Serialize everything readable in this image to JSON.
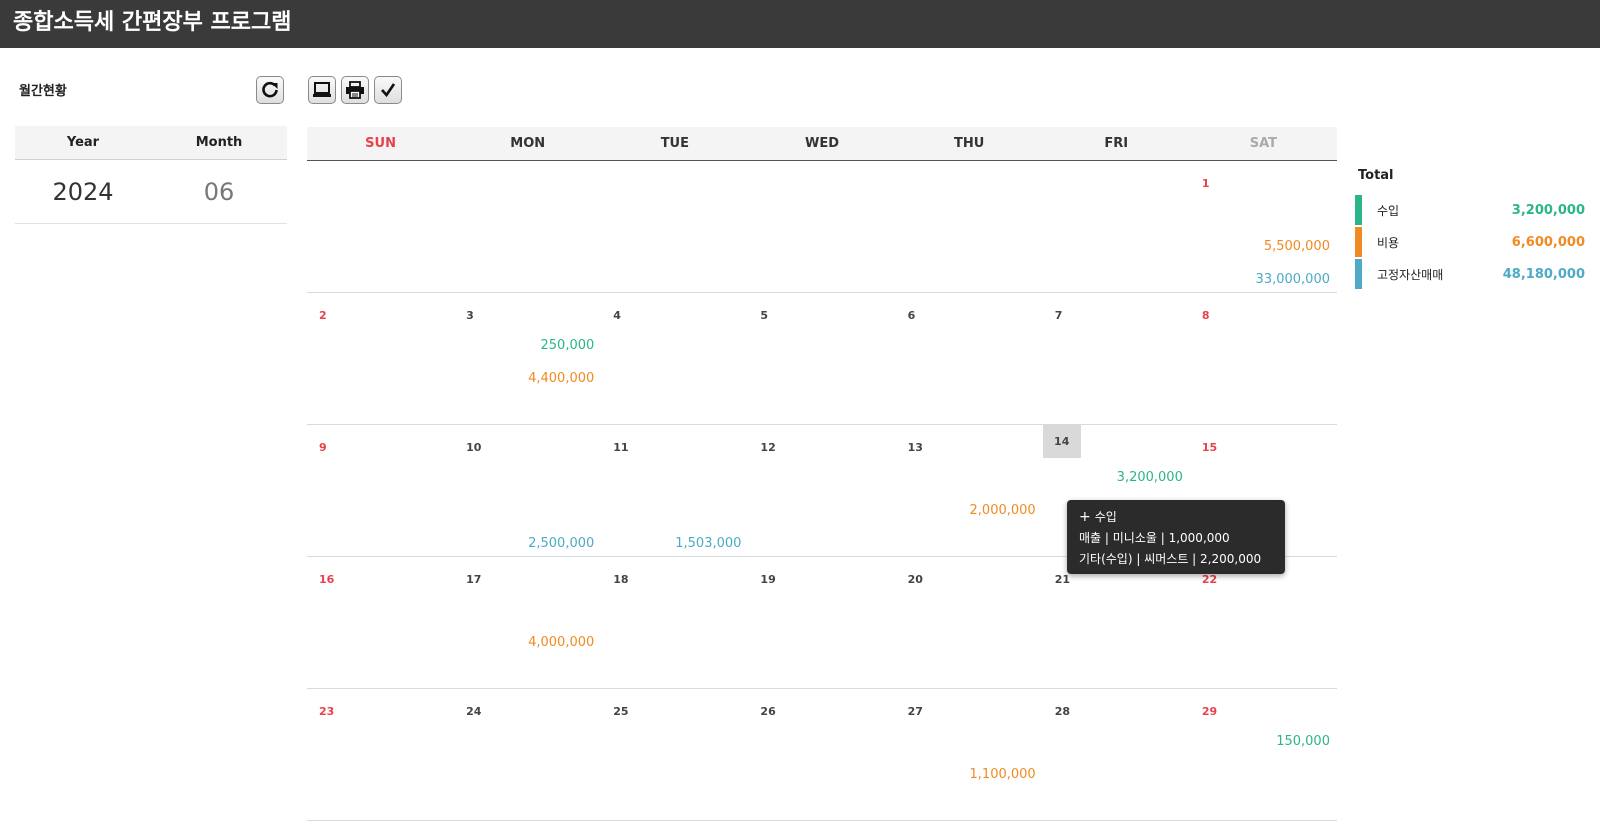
{
  "app": {
    "title": "종합소득세 간편장부 프로그램"
  },
  "left": {
    "section_label": "월간현황",
    "year_header": "Year",
    "month_header": "Month",
    "year": "2024",
    "month": "06"
  },
  "toolbar": {
    "refresh_icon": "refresh-icon",
    "computer_icon": "computer-icon",
    "print_icon": "printer-icon",
    "check_icon": "checkmark-icon"
  },
  "calendar": {
    "weekdays": [
      "SUN",
      "MON",
      "TUE",
      "WED",
      "THU",
      "FRI",
      "SAT"
    ],
    "today": "14",
    "weeks": [
      [
        {
          "day": "",
          "income": "",
          "expense": "",
          "asset": ""
        },
        {
          "day": "",
          "income": "",
          "expense": "",
          "asset": ""
        },
        {
          "day": "",
          "income": "",
          "expense": "",
          "asset": ""
        },
        {
          "day": "",
          "income": "",
          "expense": "",
          "asset": ""
        },
        {
          "day": "",
          "income": "",
          "expense": "",
          "asset": ""
        },
        {
          "day": "",
          "income": "",
          "expense": "",
          "asset": ""
        },
        {
          "day": "1",
          "income": "",
          "expense": "5,500,000",
          "asset": "33,000,000"
        }
      ],
      [
        {
          "day": "2",
          "income": "",
          "expense": "",
          "asset": ""
        },
        {
          "day": "3",
          "income": "250,000",
          "expense": "4,400,000",
          "asset": ""
        },
        {
          "day": "4",
          "income": "",
          "expense": "",
          "asset": ""
        },
        {
          "day": "5",
          "income": "",
          "expense": "",
          "asset": ""
        },
        {
          "day": "6",
          "income": "",
          "expense": "",
          "asset": ""
        },
        {
          "day": "7",
          "income": "",
          "expense": "",
          "asset": ""
        },
        {
          "day": "8",
          "income": "",
          "expense": "",
          "asset": ""
        }
      ],
      [
        {
          "day": "9",
          "income": "",
          "expense": "",
          "asset": ""
        },
        {
          "day": "10",
          "income": "",
          "expense": "",
          "asset": "2,500,000"
        },
        {
          "day": "11",
          "income": "",
          "expense": "",
          "asset": "1,503,000"
        },
        {
          "day": "12",
          "income": "",
          "expense": "",
          "asset": ""
        },
        {
          "day": "13",
          "income": "",
          "expense": "2,000,000",
          "asset": ""
        },
        {
          "day": "14",
          "income": "3,200,000",
          "expense": "",
          "asset": ""
        },
        {
          "day": "15",
          "income": "",
          "expense": "",
          "asset": ""
        }
      ],
      [
        {
          "day": "16",
          "income": "",
          "expense": "",
          "asset": ""
        },
        {
          "day": "17",
          "income": "",
          "expense": "4,000,000",
          "asset": ""
        },
        {
          "day": "18",
          "income": "",
          "expense": "",
          "asset": ""
        },
        {
          "day": "19",
          "income": "",
          "expense": "",
          "asset": ""
        },
        {
          "day": "20",
          "income": "",
          "expense": "",
          "asset": ""
        },
        {
          "day": "21",
          "income": "",
          "expense": "",
          "asset": ""
        },
        {
          "day": "22",
          "income": "",
          "expense": "",
          "asset": ""
        }
      ],
      [
        {
          "day": "23",
          "income": "",
          "expense": "",
          "asset": ""
        },
        {
          "day": "24",
          "income": "",
          "expense": "",
          "asset": ""
        },
        {
          "day": "25",
          "income": "",
          "expense": "",
          "asset": ""
        },
        {
          "day": "26",
          "income": "",
          "expense": "",
          "asset": ""
        },
        {
          "day": "27",
          "income": "",
          "expense": "1,100,000",
          "asset": ""
        },
        {
          "day": "28",
          "income": "",
          "expense": "",
          "asset": ""
        },
        {
          "day": "29",
          "income": "150,000",
          "expense": "",
          "asset": ""
        }
      ]
    ]
  },
  "totals": {
    "title": "Total",
    "rows": [
      {
        "label": "수입",
        "value": "3,200,000",
        "color": "#2bb58b"
      },
      {
        "label": "비용",
        "value": "6,600,000",
        "color": "#f08a22"
      },
      {
        "label": "고정자산매매",
        "value": "48,180,000",
        "color": "#4eaac6"
      }
    ]
  },
  "tooltip": {
    "plus": "+",
    "title": "수입",
    "line1": "매출 | 미니소울 | 1,000,000",
    "line2": "기타(수입) | 씨머스트 | 2,200,000"
  },
  "colors": {
    "income": "#2bb58b",
    "expense": "#f08a22",
    "asset": "#4eaac6",
    "sunday": "#e8414b",
    "titlebar": "#3a3a3a"
  }
}
